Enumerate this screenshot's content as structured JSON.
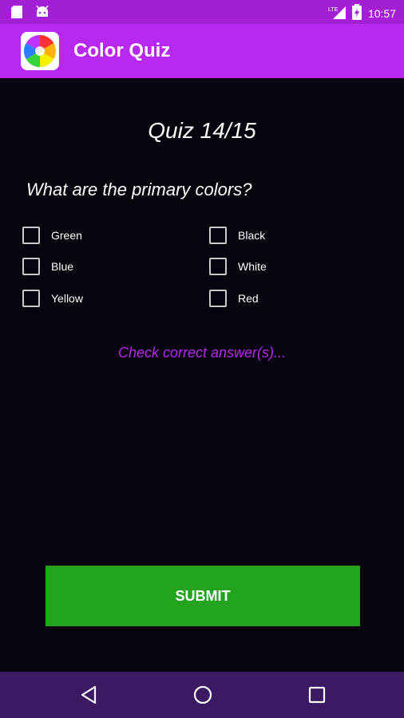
{
  "status_bar": {
    "time": "10:57",
    "network": "LTE",
    "icons": [
      "sd-card-icon",
      "android-icon",
      "lte-signal-icon",
      "battery-icon"
    ]
  },
  "app_bar": {
    "title": "Color Quiz",
    "icon": "color-wheel-icon",
    "color": "#b727f0"
  },
  "quiz": {
    "title": "Quiz 14/15",
    "question": "What are the primary colors?",
    "options_left": [
      {
        "label": "Green",
        "checked": false
      },
      {
        "label": "Blue",
        "checked": false
      },
      {
        "label": "Yellow",
        "checked": false
      }
    ],
    "options_right": [
      {
        "label": "Black",
        "checked": false
      },
      {
        "label": "White",
        "checked": false
      },
      {
        "label": "Red",
        "checked": false
      }
    ],
    "hint": "Check correct answer(s)...",
    "submit_label": "SUBMIT",
    "submit_color": "#23a31e"
  },
  "nav_bar": {
    "icons": [
      "back-icon",
      "home-icon",
      "recents-icon"
    ]
  }
}
